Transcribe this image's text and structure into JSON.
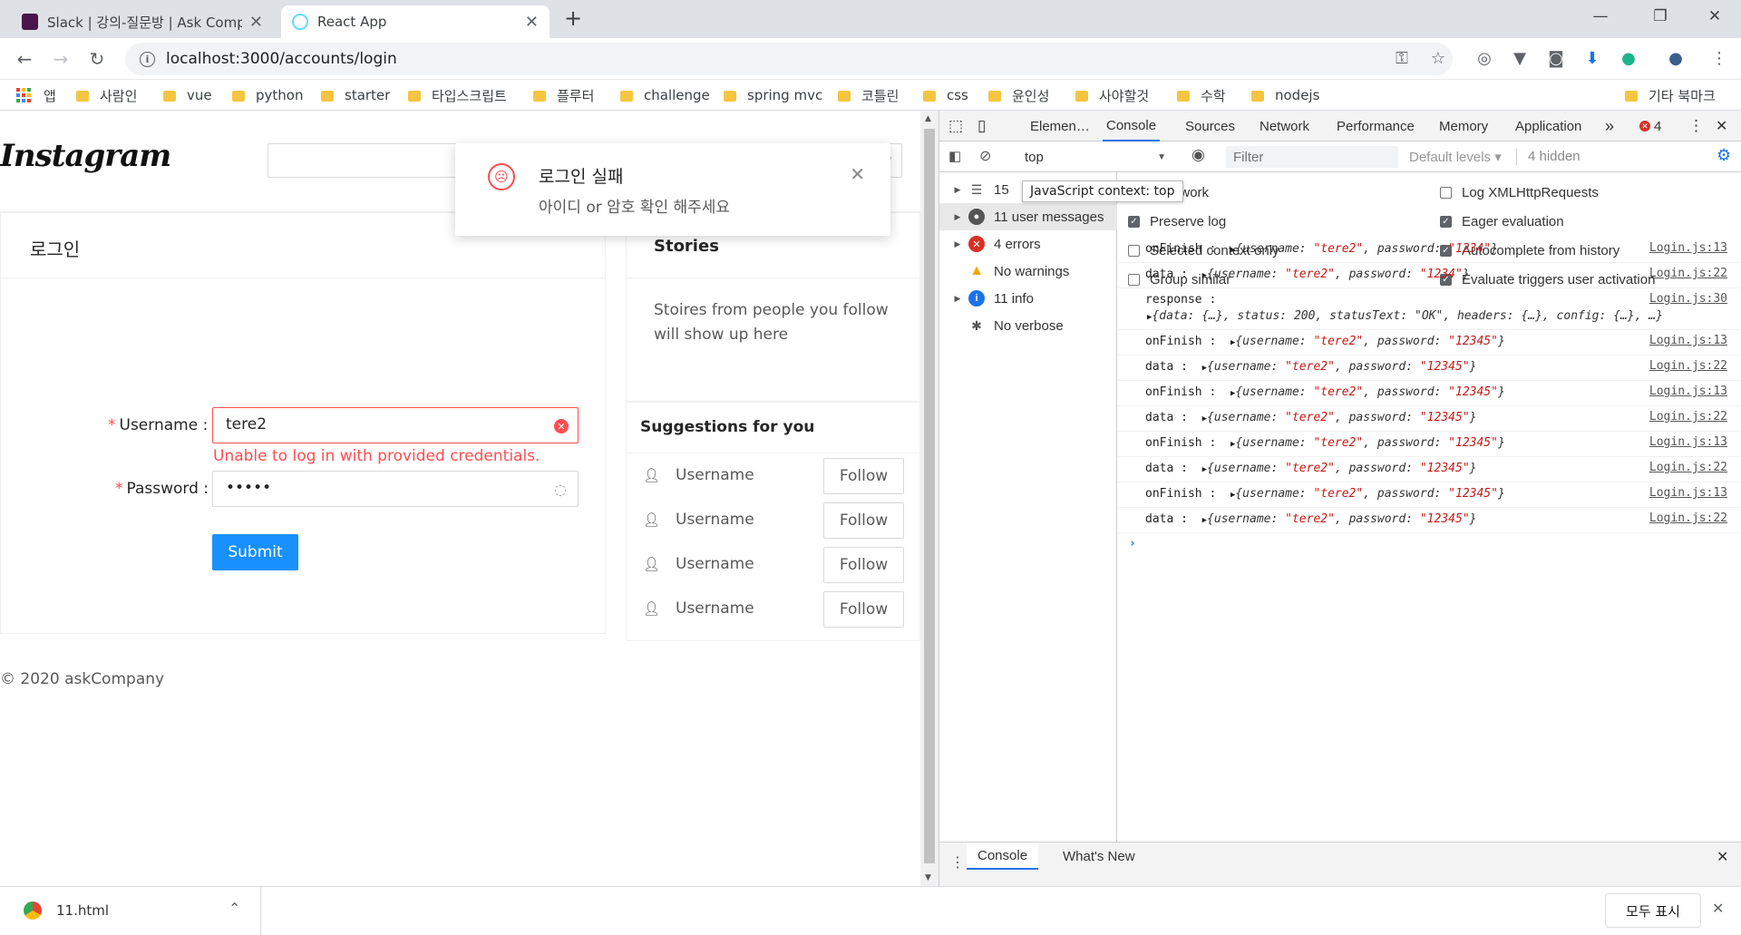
{
  "tabs": [
    {
      "title": "Slack | 강의-질문방 | Ask Comp",
      "active": false
    },
    {
      "title": "React App",
      "active": true
    }
  ],
  "window_controls": {
    "minimize": "—",
    "maximize": "❐",
    "close": "✕"
  },
  "address_bar": {
    "url": "localhost:3000/accounts/login"
  },
  "bookmarks": {
    "apps_label": "앱",
    "items": [
      "사람인",
      "vue",
      "python",
      "starter",
      "타입스크립트",
      "플루터",
      "challenge",
      "spring mvc",
      "코틀린",
      "css",
      "윤인성",
      "사야할것",
      "수학",
      "nodejs"
    ],
    "other": "기타 북마크"
  },
  "ig": {
    "logo": "Instagram",
    "login_title": "로그인",
    "username_label": "Username",
    "username_value": "tere2",
    "password_label": "Password",
    "password_mask": "•••••",
    "error_text": "Unable to log in with provided credentials.",
    "submit_label": "Submit",
    "stories_title": "Stories",
    "stories_body": "Stoires from people you follow will show up here",
    "suggestions_title": "Suggestions for you",
    "suggestions": [
      {
        "name": "Username",
        "button": "Follow"
      },
      {
        "name": "Username",
        "button": "Follow"
      },
      {
        "name": "Username",
        "button": "Follow"
      },
      {
        "name": "Username",
        "button": "Follow"
      }
    ],
    "footer": "© 2020 askCompany"
  },
  "notification": {
    "title": "로그인 실패",
    "description": "아이디 or 암호 확인 해주세요"
  },
  "devtools": {
    "tabs": [
      "Elemen…",
      "Console",
      "Sources",
      "Network",
      "Performance",
      "Memory",
      "Application"
    ],
    "active_tab": "Console",
    "more_tabs": "»",
    "error_count": "4",
    "context": "top",
    "filter_placeholder": "Filter",
    "levels": "Default levels",
    "hidden": "4 hidden",
    "tooltip": "JavaScript context: top",
    "sidebar": [
      {
        "label": "15",
        "icon": "list-icon"
      },
      {
        "label": "11 user messages",
        "icon": "user-icon"
      },
      {
        "label": "4 errors",
        "icon": "error-icon"
      },
      {
        "label": "No warnings",
        "icon": "warning-icon"
      },
      {
        "label": "11 info",
        "icon": "info-icon"
      },
      {
        "label": "No verbose",
        "icon": "bug-icon"
      }
    ],
    "settings": {
      "left": [
        {
          "label": "e network",
          "checked": false
        },
        {
          "label": "Preserve log",
          "checked": true
        },
        {
          "label": "Selected context only",
          "checked": false
        },
        {
          "label": "Group similar",
          "checked": false
        }
      ],
      "right": [
        {
          "label": "Log XMLHttpRequests",
          "checked": false
        },
        {
          "label": "Eager evaluation",
          "checked": true
        },
        {
          "label": "Autocomplete from history",
          "checked": true
        },
        {
          "label": "Evaluate triggers user activation",
          "checked": true
        }
      ]
    },
    "console": [
      {
        "label": "onFinish :",
        "user": "\"tere2\"",
        "pw": "\"1234\"",
        "src": "Login.js:13"
      },
      {
        "label": "data :",
        "user": "\"tere2\"",
        "pw": "\"1234\"",
        "src": "Login.js:22"
      },
      {
        "label": "response :",
        "line2": "{data: {…}, status: 200, statusText: \"OK\", headers: {…}, config: {…}, …}",
        "src": "Login.js:30"
      },
      {
        "label": "onFinish :",
        "user": "\"tere2\"",
        "pw": "\"12345\"",
        "src": "Login.js:13"
      },
      {
        "label": "data :",
        "user": "\"tere2\"",
        "pw": "\"12345\"",
        "src": "Login.js:22"
      },
      {
        "label": "onFinish :",
        "user": "\"tere2\"",
        "pw": "\"12345\"",
        "src": "Login.js:13"
      },
      {
        "label": "data :",
        "user": "\"tere2\"",
        "pw": "\"12345\"",
        "src": "Login.js:22"
      },
      {
        "label": "onFinish :",
        "user": "\"tere2\"",
        "pw": "\"12345\"",
        "src": "Login.js:13"
      },
      {
        "label": "data :",
        "user": "\"tere2\"",
        "pw": "\"12345\"",
        "src": "Login.js:22"
      },
      {
        "label": "onFinish :",
        "user": "\"tere2\"",
        "pw": "\"12345\"",
        "src": "Login.js:13"
      },
      {
        "label": "data :",
        "user": "\"tere2\"",
        "pw": "\"12345\"",
        "src": "Login.js:22"
      }
    ],
    "object_prefix": "{username: ",
    "object_mid": ", password: ",
    "object_suffix": "}",
    "prompt": "›",
    "drawer_tabs": [
      "Console",
      "What's New"
    ]
  },
  "download": {
    "file": "11.html",
    "show_all": "모두 표시"
  },
  "colors": {
    "accent": "#1890ff",
    "error": "#ff4d4f",
    "chrome_blue": "#1a73e8"
  }
}
